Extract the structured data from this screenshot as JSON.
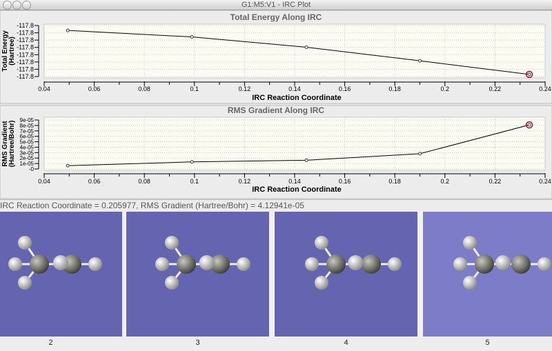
{
  "window": {
    "title": "G1:M5:V1 - IRC Plot"
  },
  "status_text": "IRC Reaction Coordinate = 0.205977,  RMS Gradient (Hartree/Bohr) = 4.12941e-05",
  "frames": [
    {
      "label": "2",
      "color": "#6464b0"
    },
    {
      "label": "3",
      "color": "#6464b0"
    },
    {
      "label": "4",
      "color": "#6464b0"
    },
    {
      "label": "5",
      "color": "#7c7cc8"
    }
  ],
  "chart_data": [
    {
      "type": "line",
      "title": "Total Energy Along IRC",
      "xlabel": "IRC Reaction Coordinate",
      "ylabel": [
        "Total Energy",
        "(Hartree)"
      ],
      "x": [
        0.0494,
        0.099,
        0.1447,
        0.19,
        0.2337
      ],
      "values": [
        -117.7922,
        -117.7934,
        -117.7953,
        -117.7978,
        -117.8003
      ],
      "xlim": [
        0.04,
        0.24
      ],
      "ylim": [
        -117.8007,
        -117.7913
      ],
      "xticks": [
        "0.04",
        "0.06",
        "0.08",
        "0.1",
        "0.12",
        "0.14",
        "0.16",
        "0.18",
        "0.2",
        "0.22",
        "0.24"
      ],
      "yticks": [
        "-117.8",
        "-117.8",
        "-117.8",
        "-117.8",
        "-117.8",
        "-117.8",
        "-117.8",
        "-117.8"
      ],
      "grid": true,
      "highlight_index": 4
    },
    {
      "type": "line",
      "title": "RMS Gradient Along IRC",
      "xlabel": "IRC Reaction Coordinate",
      "ylabel": [
        "RMS Gradient",
        "(Hartree/Bohr)"
      ],
      "x": [
        0.0494,
        0.099,
        0.1447,
        0.19,
        0.2337
      ],
      "values": [
        6e-06,
        1.3e-05,
        1.6e-05,
        2.8e-05,
        8.1e-05
      ],
      "xlim": [
        0.04,
        0.24
      ],
      "ylim": [
        0,
        9e-05
      ],
      "xticks": [
        "0.04",
        "0.06",
        "0.08",
        "0.1",
        "0.12",
        "0.14",
        "0.16",
        "0.18",
        "0.2",
        "0.22",
        "0.24"
      ],
      "yticks": [
        "-0",
        "1e-05",
        "2e-05",
        "3e-05",
        "4e-05",
        "5e-05",
        "6e-05",
        "7e-05",
        "8e-05",
        "9e-05"
      ],
      "grid": true,
      "highlight_index": 4
    }
  ]
}
